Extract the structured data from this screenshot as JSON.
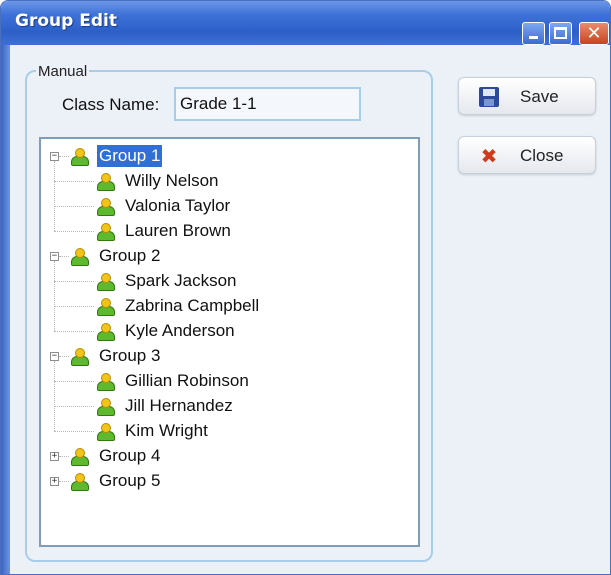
{
  "window": {
    "title": "Group Edit"
  },
  "form": {
    "legend": "Manual",
    "class_name_label": "Class Name:",
    "class_name_value": "Grade 1-1"
  },
  "tree": {
    "groups": [
      {
        "label": "Group 1",
        "expanded": true,
        "selected": true,
        "members": [
          "Willy Nelson",
          "Valonia Taylor",
          "Lauren Brown"
        ]
      },
      {
        "label": "Group 2",
        "expanded": true,
        "members": [
          "Spark Jackson",
          "Zabrina Campbell",
          "Kyle Anderson"
        ]
      },
      {
        "label": "Group 3",
        "expanded": true,
        "members": [
          "Gillian Robinson",
          "Jill  Hernandez",
          "Kim Wright"
        ]
      },
      {
        "label": "Group 4",
        "expanded": false,
        "members": []
      },
      {
        "label": "Group 5",
        "expanded": false,
        "members": []
      }
    ],
    "expand_glyph": "+",
    "collapse_glyph": "−",
    "selection_color": "#2f6fd6"
  },
  "buttons": {
    "save_label": "Save",
    "close_label": "Close"
  },
  "icons": {
    "save": "floppy-disk-icon",
    "close": "red-x-icon",
    "node": "user-group-icon",
    "window_close": "✕"
  }
}
